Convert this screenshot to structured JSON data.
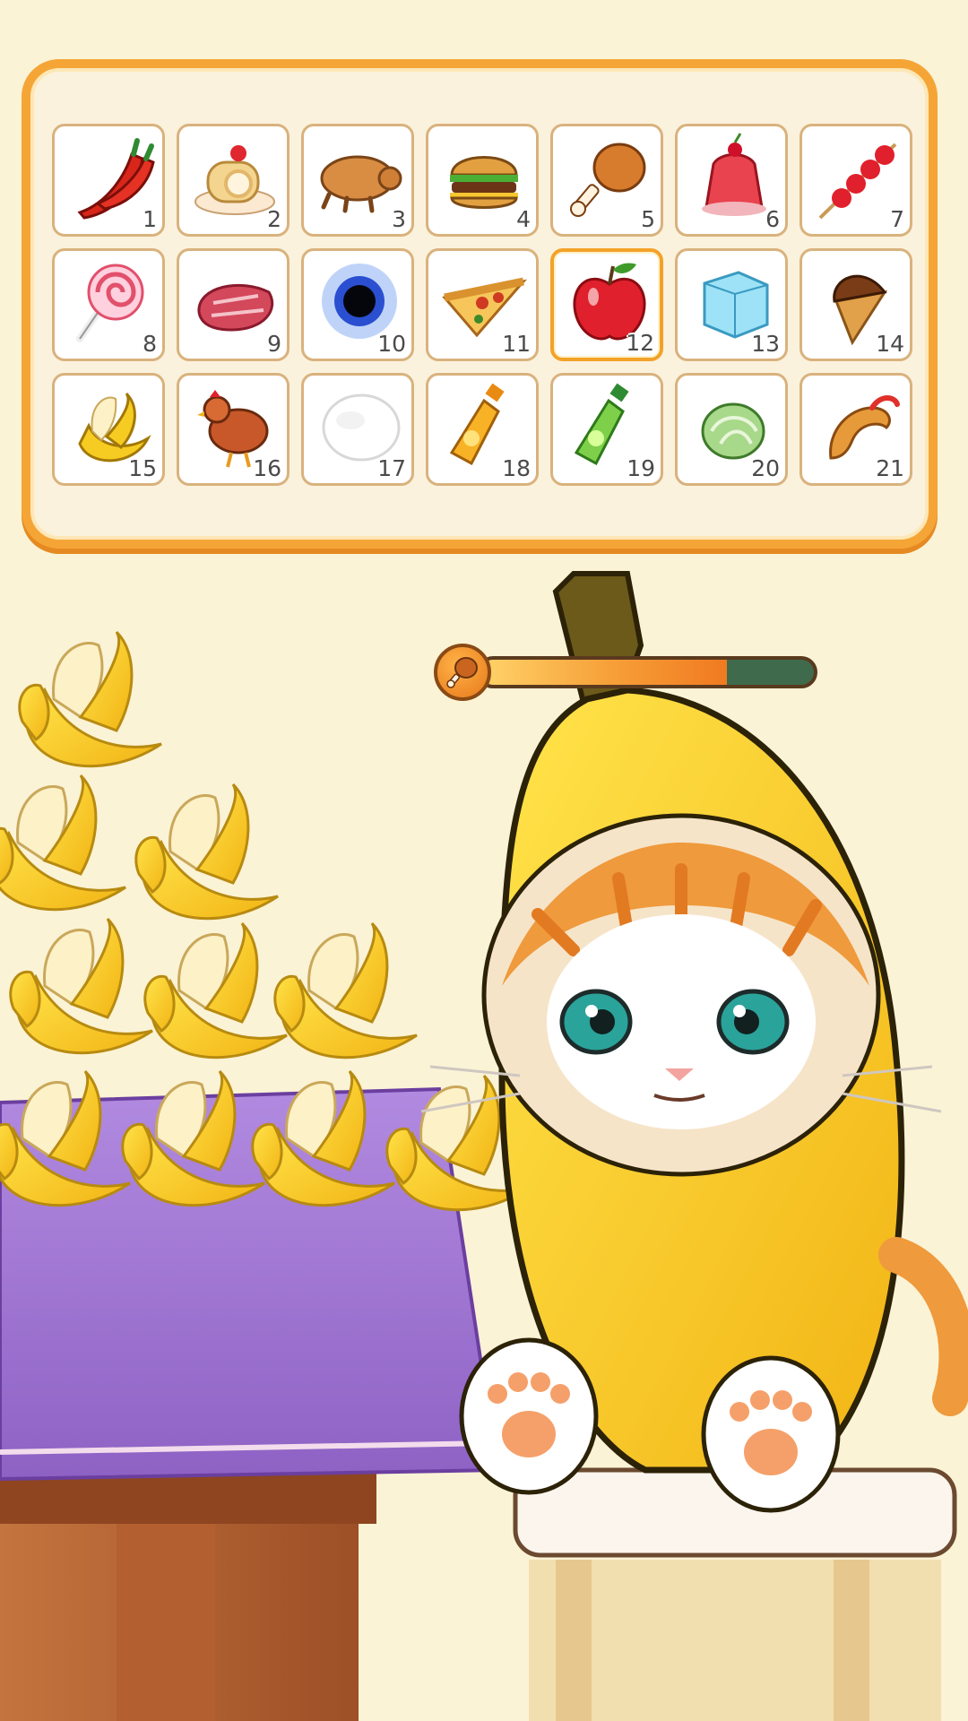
{
  "food_panel": {
    "items": [
      {
        "number": "1",
        "icon": "chili-pepper-icon"
      },
      {
        "number": "2",
        "icon": "swiss-roll-cake-icon"
      },
      {
        "number": "3",
        "icon": "roast-piglet-icon"
      },
      {
        "number": "4",
        "icon": "hamburger-icon"
      },
      {
        "number": "5",
        "icon": "fried-drumstick-icon"
      },
      {
        "number": "6",
        "icon": "jelly-pudding-icon"
      },
      {
        "number": "7",
        "icon": "candied-fruit-skewer-icon"
      },
      {
        "number": "8",
        "icon": "lollipop-icon"
      },
      {
        "number": "9",
        "icon": "raw-steak-icon"
      },
      {
        "number": "10",
        "icon": "black-hole-icon"
      },
      {
        "number": "11",
        "icon": "pizza-slice-icon"
      },
      {
        "number": "12",
        "icon": "apple-icon"
      },
      {
        "number": "13",
        "icon": "ice-cube-icon"
      },
      {
        "number": "14",
        "icon": "chocolate-ice-cream-cone-icon"
      },
      {
        "number": "15",
        "icon": "peeled-banana-icon"
      },
      {
        "number": "16",
        "icon": "chicken-icon"
      },
      {
        "number": "17",
        "icon": "cotton-ball-icon"
      },
      {
        "number": "18",
        "icon": "orange-juice-bottle-icon"
      },
      {
        "number": "19",
        "icon": "green-soda-bottle-icon"
      },
      {
        "number": "20",
        "icon": "cabbage-icon"
      },
      {
        "number": "21",
        "icon": "fried-shrimp-icon"
      }
    ],
    "selected_number": "12"
  },
  "hunger_bar": {
    "icon": "drumstick-icon",
    "fill_fraction": 0.74
  },
  "scene": {
    "character": "banana-cat-icon",
    "table_stack": "banana-pyramid",
    "banana_count": 10
  },
  "colors": {
    "panel_border": "#f5a536",
    "panel_bg": "#fbf2dd",
    "tablecloth": "#9b72c9",
    "banana": "#f6cc22",
    "cat_orange": "#ef9a3c"
  }
}
